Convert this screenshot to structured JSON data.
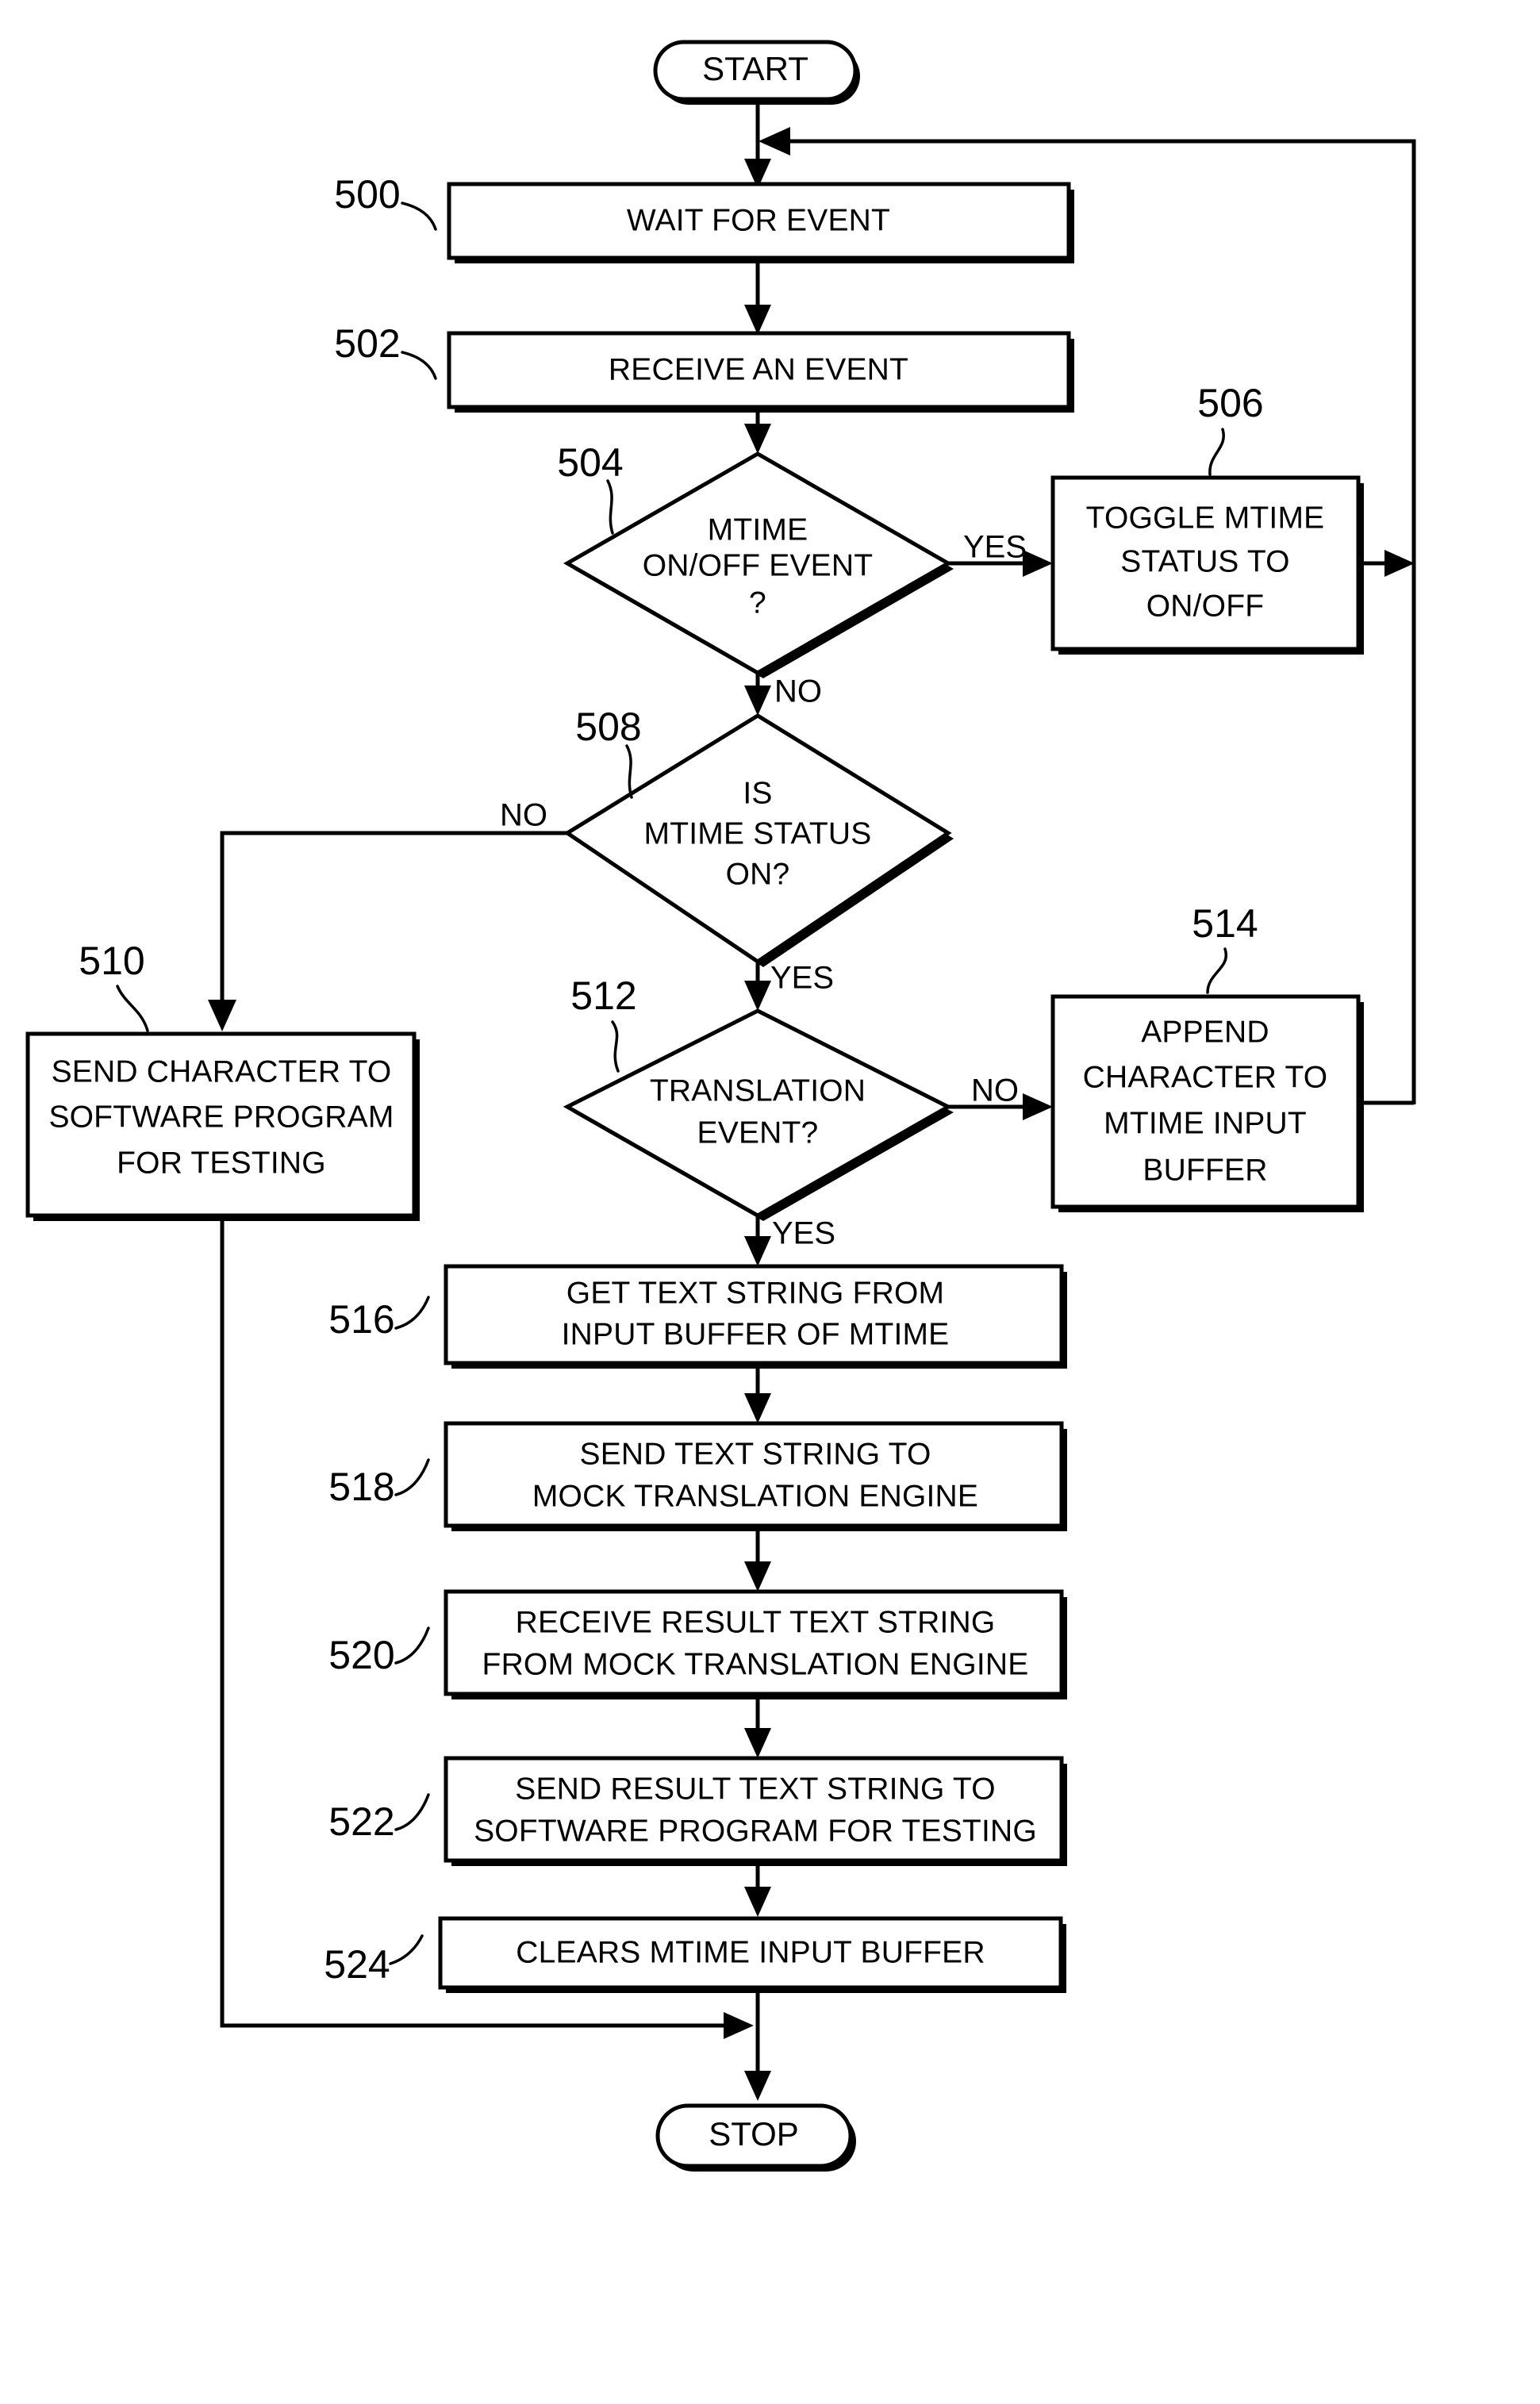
{
  "diagram": {
    "kind": "flowchart",
    "terminals": {
      "start": "START",
      "stop": "STOP"
    },
    "branch_labels": {
      "d504_yes": "YES",
      "d504_no": "NO",
      "d508_no": "NO",
      "d508_yes": "YES",
      "d512_no": "NO",
      "d512_yes": "YES"
    },
    "nodes": [
      {
        "ref": "500",
        "type": "process",
        "lines": [
          "WAIT FOR EVENT"
        ]
      },
      {
        "ref": "502",
        "type": "process",
        "lines": [
          "RECEIVE AN EVENT"
        ]
      },
      {
        "ref": "504",
        "type": "decision",
        "lines": [
          "MTIME",
          "ON/OFF EVENT",
          "?"
        ]
      },
      {
        "ref": "506",
        "type": "process",
        "lines": [
          "TOGGLE MTIME",
          "STATUS TO",
          "ON/OFF"
        ]
      },
      {
        "ref": "508",
        "type": "decision",
        "lines": [
          "IS",
          "MTIME STATUS",
          "ON?"
        ]
      },
      {
        "ref": "510",
        "type": "process",
        "lines": [
          "SEND CHARACTER TO",
          "SOFTWARE PROGRAM",
          "FOR TESTING"
        ]
      },
      {
        "ref": "512",
        "type": "decision",
        "lines": [
          "TRANSLATION",
          "EVENT?"
        ]
      },
      {
        "ref": "514",
        "type": "process",
        "lines": [
          "APPEND",
          "CHARACTER TO",
          "MTIME INPUT",
          "BUFFER"
        ]
      },
      {
        "ref": "516",
        "type": "process",
        "lines": [
          "GET TEXT STRING FROM",
          "INPUT BUFFER OF MTIME"
        ]
      },
      {
        "ref": "518",
        "type": "process",
        "lines": [
          "SEND TEXT STRING TO",
          "MOCK TRANSLATION ENGINE"
        ]
      },
      {
        "ref": "520",
        "type": "process",
        "lines": [
          "RECEIVE RESULT TEXT STRING",
          "FROM MOCK TRANSLATION ENGINE"
        ]
      },
      {
        "ref": "522",
        "type": "process",
        "lines": [
          "SEND RESULT TEXT STRING TO",
          "SOFTWARE PROGRAM FOR TESTING"
        ]
      },
      {
        "ref": "524",
        "type": "process",
        "lines": [
          "CLEARS MTIME INPUT BUFFER"
        ]
      }
    ],
    "colors": {
      "stroke": "#000000",
      "fill": "#ffffff",
      "background": "#ffffff"
    }
  }
}
